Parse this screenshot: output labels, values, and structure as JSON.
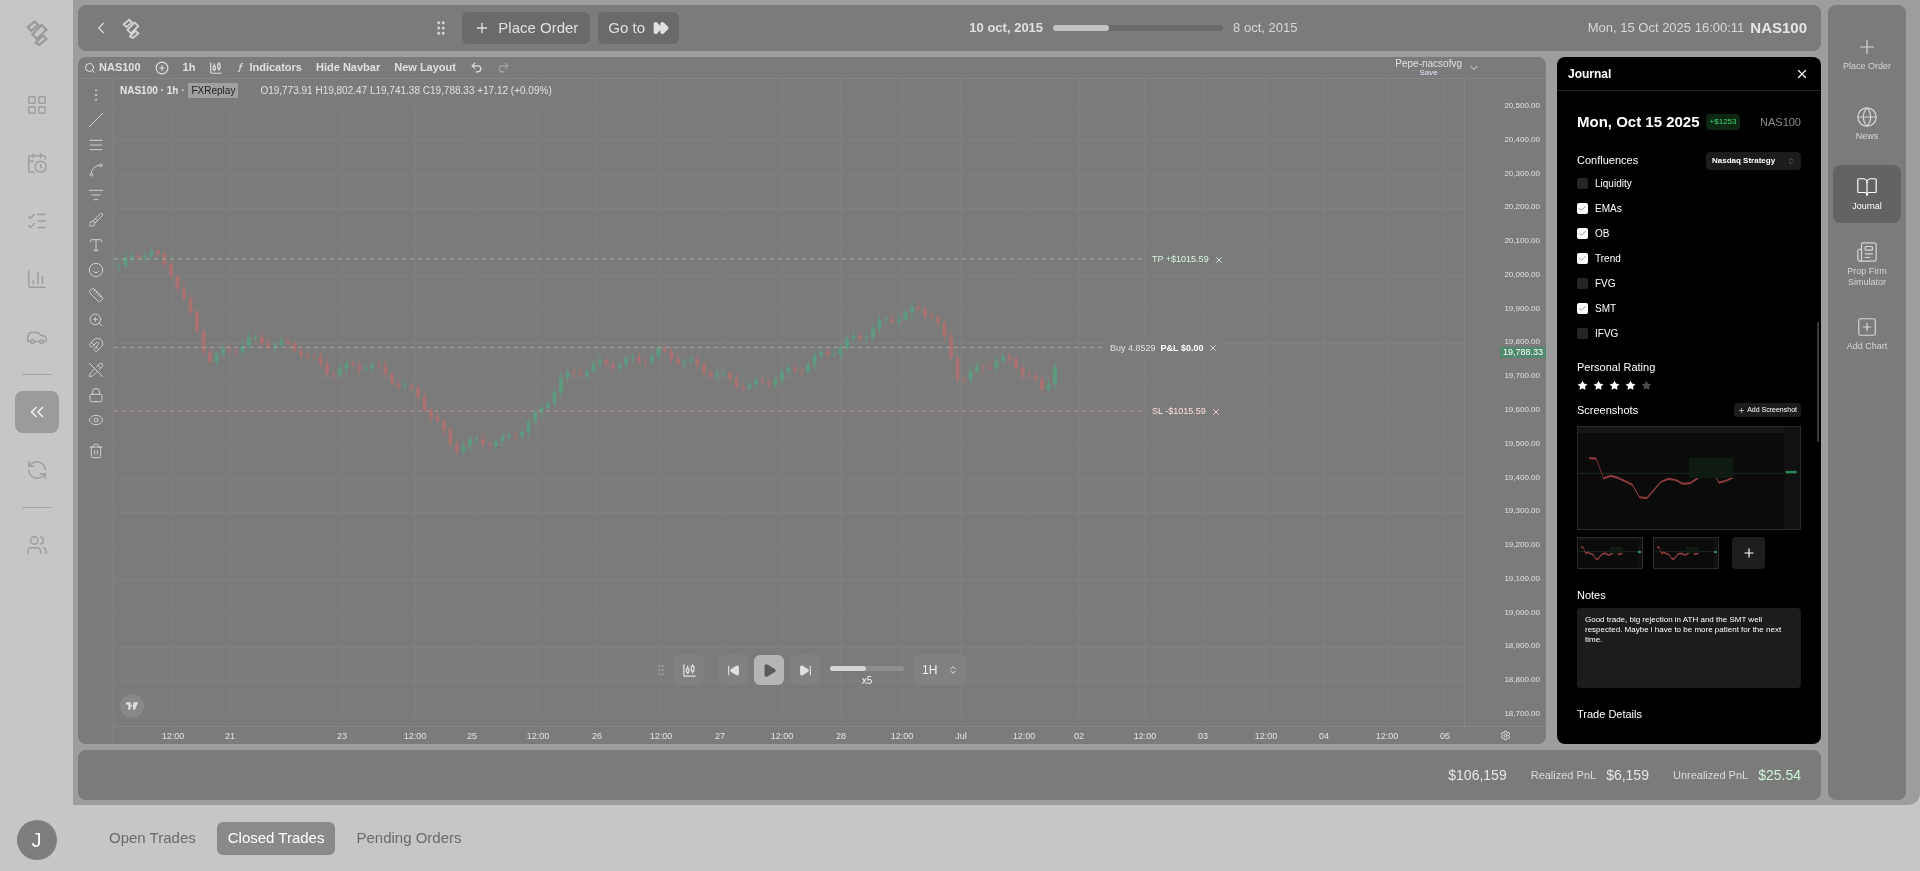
{
  "sidebar": {
    "buttons": [
      {
        "selected": false
      },
      {
        "selected": false
      },
      {
        "selected": false
      },
      {
        "selected": false
      },
      {
        "selected": false
      },
      {
        "selected": true
      },
      {
        "selected": false
      },
      {
        "selected": false
      }
    ],
    "avatar": "J"
  },
  "top_bar": {
    "place_order": "Place Order",
    "go_to": "Go to",
    "replay_start": "10 oct, 2015",
    "replay_progress": {
      "level": 0.33
    },
    "replay_end": "8 oct, 2015",
    "current_time": "Mon, 15 Oct 2025 16:00:11",
    "symbol": "NAS100"
  },
  "chart": {
    "toolbar": {
      "symbol": "NAS100",
      "interval": "1h",
      "indicators": "Indicators",
      "hide_navbar": "Hide Navbar",
      "new_layout": "New Layout",
      "layout_name": "Pepe-nacsofvg",
      "save": "Save"
    },
    "legend": {
      "title": "NAS100 · 1h ·",
      "source": "FXReplay",
      "ohlc": "O19,773.91 H19,802.47 L19,741.38 C19,788.33 +17.12 (+0.09%)"
    },
    "lines": {
      "take_profit": "TP +$1015.59",
      "position": "Buy 4.8529",
      "pnl": "P&L $0.00",
      "stop_loss": "SL -$1015.59",
      "last_price": "19,788.33"
    },
    "y_axis_labels": [
      "20,500.00",
      "20,400.00",
      "20,300.00",
      "20,200.00",
      "20,100.00",
      "20,000.00",
      "19,900.00",
      "19,800.00",
      "19,700.00",
      "19,600.00",
      "19,500.00",
      "19,400.00",
      "19,300.00",
      "19,200.00",
      "19,100.00",
      "19,000.00",
      "18,900.00",
      "18,800.00",
      "18,700.00"
    ],
    "x_axis_labels": [
      "12:00",
      "21",
      "23",
      "12:00",
      "25",
      "12:00",
      "26",
      "12:00",
      "27",
      "12:00",
      "28",
      "12:00",
      "Jul",
      "12:00",
      "02",
      "12:00",
      "03",
      "12:00",
      "04",
      "12:00",
      "05"
    ],
    "replay": {
      "speed": {
        "level": 0.49
      },
      "speed_label": "x5",
      "timeframe": "1H"
    }
  },
  "journal": {
    "title": "Journal",
    "date": "Mon, Oct 15 2025",
    "pnl": "+$1253",
    "symbol": "NAS100",
    "confluences_label": "Confluences",
    "strategy": "Nasdaq Strategy",
    "confluences": [
      {
        "label": "Liquidity",
        "checked": false
      },
      {
        "label": "EMAs",
        "checked": true
      },
      {
        "label": "OB",
        "checked": true
      },
      {
        "label": "Trend",
        "checked": true
      },
      {
        "label": "FVG",
        "checked": false
      },
      {
        "label": "SMT",
        "checked": true
      },
      {
        "label": "IFVG",
        "checked": false
      }
    ],
    "rating": {
      "label": "Personal Rating",
      "stars": 4
    },
    "screenshots_label": "Screenshots",
    "add_screenshot": "Add Screenshot",
    "notes_label": "Notes",
    "notes": "Good trade, big rejection in ATH and the SMT well respected. Maybe i have to be more patient for the next time.",
    "trade_details": "Trade Details"
  },
  "right_sidebar": [
    {
      "label": "Place Order",
      "selected": false
    },
    {
      "label": "News",
      "selected": false
    },
    {
      "label": "Journal",
      "selected": true
    },
    {
      "label": "Prop Firm Simulator",
      "selected": false
    },
    {
      "label": "Add Chart",
      "selected": false
    }
  ],
  "account_bar": {
    "balance": "$106,159",
    "realized_label": "Realized PnL",
    "realized": "$6,159",
    "unrealized_label": "Unrealized PnL",
    "unrealized": "$25.54"
  },
  "bottom_tabs": [
    {
      "label": "Open Trades",
      "selected": false
    },
    {
      "label": "Closed Trades",
      "selected": true
    },
    {
      "label": "Pending Orders",
      "selected": false
    }
  ]
}
